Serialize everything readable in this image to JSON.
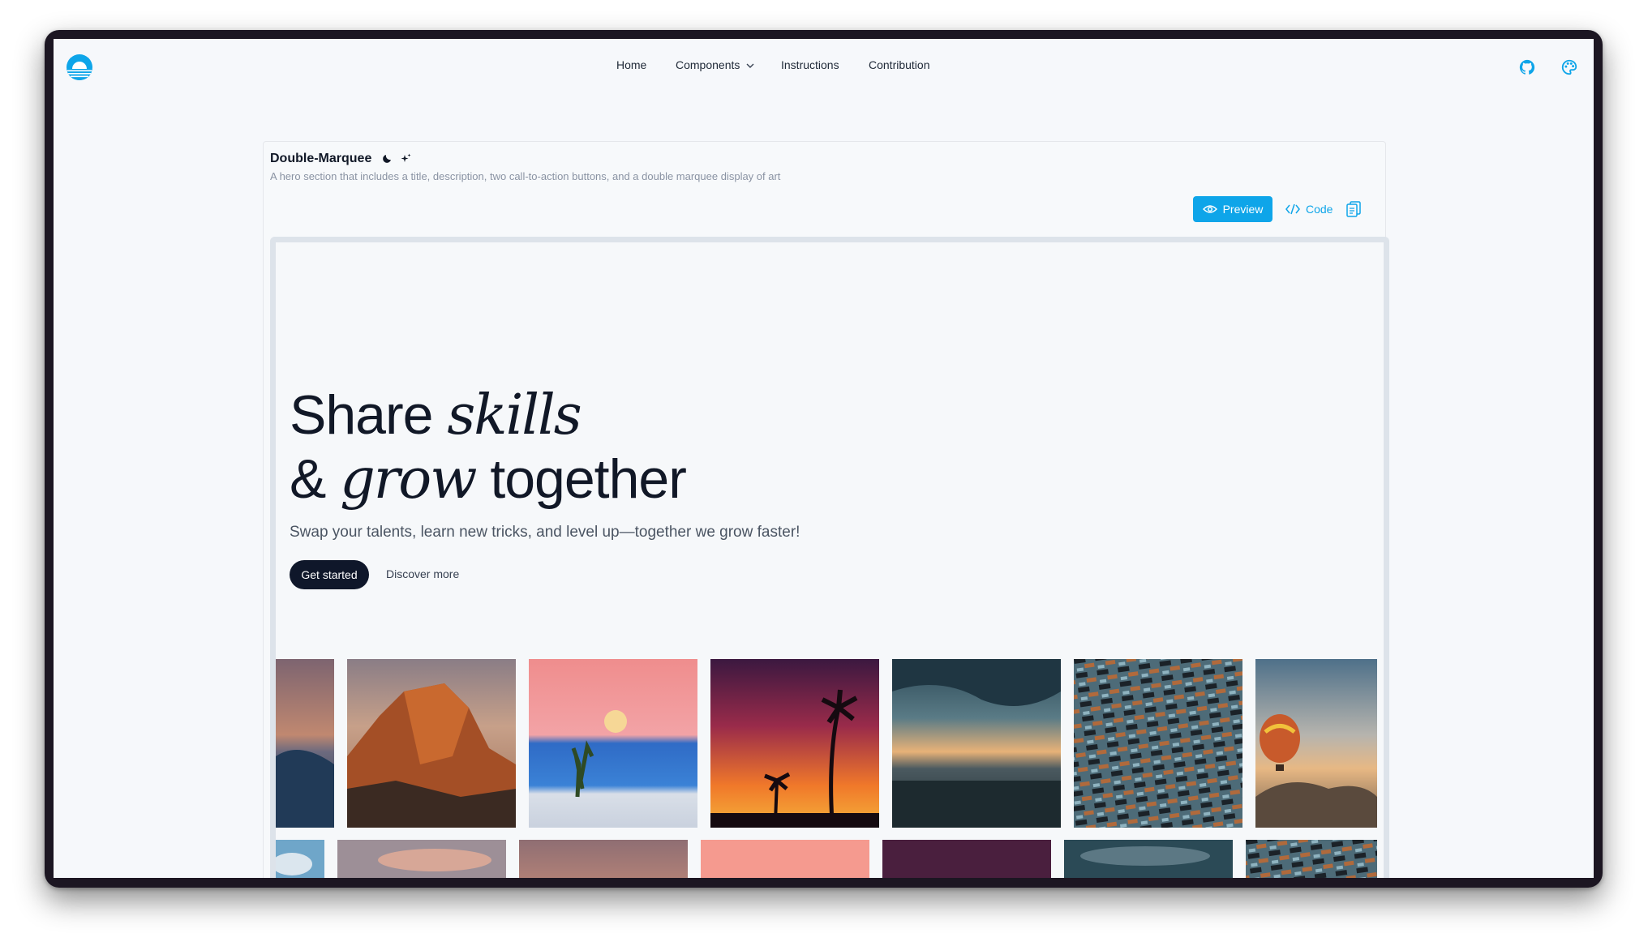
{
  "nav": {
    "home": "Home",
    "components": "Components",
    "instructions": "Instructions",
    "contribution": "Contribution"
  },
  "component": {
    "title": "Double-Marquee",
    "description": "A hero section that includes a title, description, two call-to-action buttons, and a double marquee display of art",
    "preview_label": "Preview",
    "code_label": "Code"
  },
  "hero": {
    "title_line1_a": "Share ",
    "title_line1_b": "skills",
    "title_line2_a": "& ",
    "title_line2_b": "grow",
    "title_line2_c": " together",
    "subtitle": "Swap your talents, learn new tricks, and level up—together we grow faster!",
    "cta_primary": "Get started",
    "cta_secondary": "Discover more"
  },
  "marquee": {
    "row1": [
      "ocean-clouds-photo",
      "half-dome-mountain-photo",
      "moon-desert-yucca-photo",
      "palm-sunset-photo",
      "city-sunset-clouds-photo",
      "aerial-pattern-photo",
      "hot-air-balloon-photo"
    ],
    "row2": [
      "sky-blue-photo",
      "mountain-clouds-photo",
      "sunset-photo",
      "pink-sky-photo",
      "purple-sky-photo",
      "dark-clouds-photo",
      "pattern-photo"
    ]
  },
  "colors": {
    "accent": "#0ea5e9",
    "dark_button": "#0f172a",
    "background": "#f6f8fb"
  },
  "icons": {
    "logo": "sun-over-water-logo",
    "github": "github-icon",
    "palette": "palette-icon",
    "theme": "moon-icon",
    "dark_variant": "moon-icon",
    "ai_variant": "sparkles-icon",
    "preview": "eye-icon",
    "code": "code-icon",
    "copy": "copy-icon"
  }
}
